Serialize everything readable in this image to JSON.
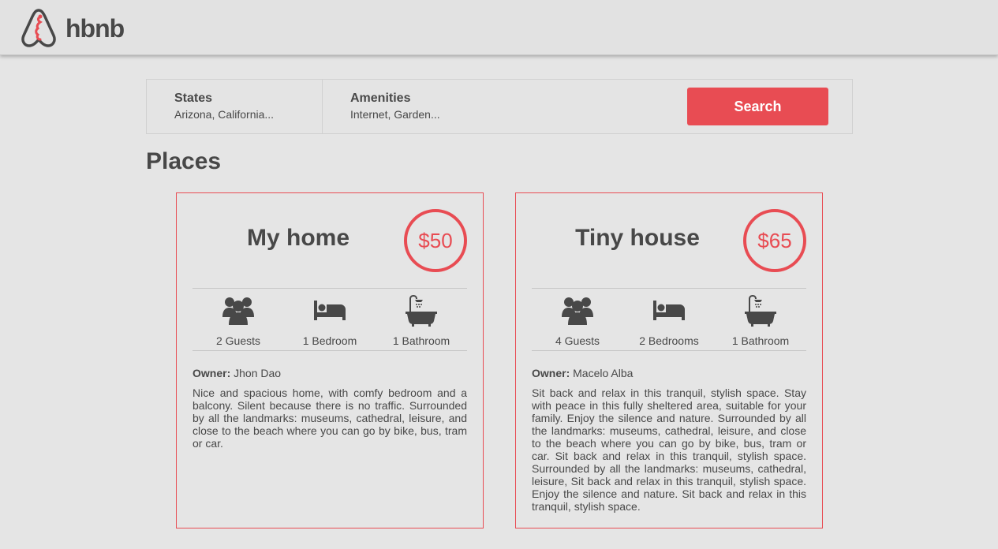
{
  "header": {
    "logo_text": "hbnb"
  },
  "colors": {
    "accent": "#e84c53",
    "text": "#484848",
    "background": "#e5e5e5"
  },
  "filters": {
    "states": {
      "title": "States",
      "value": "Arizona, California..."
    },
    "amenities": {
      "title": "Amenities",
      "value": "Internet, Garden..."
    },
    "search_label": "Search"
  },
  "places_title": "Places",
  "places": [
    {
      "title": "My home",
      "price": "$50",
      "guests": "2 Guests",
      "bedrooms": "1 Bedroom",
      "bathrooms": "1 Bathroom",
      "owner_label": "Owner:",
      "owner_name": "Jhon Dao",
      "description": "Nice and spacious home, with comfy bedroom and a balcony. Silent because there is no traffic. Surrounded by all the landmarks: museums, cathedral, leisure, and close to the beach where you can go by bike, bus, tram or car."
    },
    {
      "title": "Tiny house",
      "price": "$65",
      "guests": "4 Guests",
      "bedrooms": "2 Bedrooms",
      "bathrooms": "1 Bathroom",
      "owner_label": "Owner:",
      "owner_name": "Macelo Alba",
      "description": "Sit back and relax in this tranquil, stylish space. Stay with peace in this fully sheltered area, suitable for your family. Enjoy the silence and nature. Surrounded by all the landmarks: museums, cathedral, leisure, and close to the beach where you can go by bike, bus, tram or car. Sit back and relax in this tranquil, stylish space. Surrounded by all the landmarks: museums, cathedral, leisure, Sit back and relax in this tranquil, stylish space. Enjoy the silence and nature. Sit back and relax in this tranquil, stylish space."
    }
  ]
}
